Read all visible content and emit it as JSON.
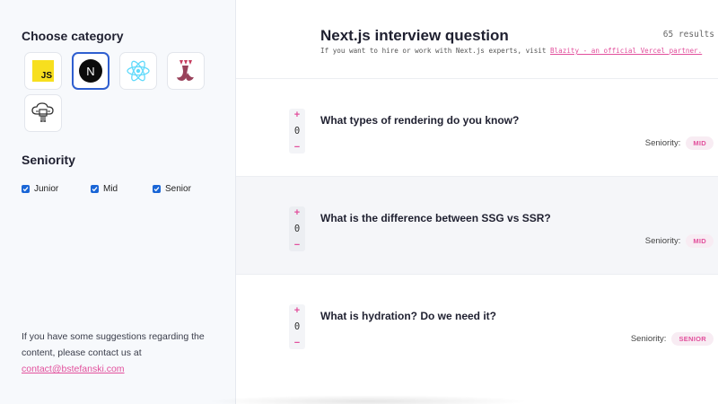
{
  "sidebar": {
    "category_title": "Choose category",
    "categories": [
      {
        "name": "javascript",
        "label": "JS",
        "selected": false
      },
      {
        "name": "nextjs",
        "label": "N",
        "selected": true
      },
      {
        "name": "react",
        "label": "",
        "selected": false
      },
      {
        "name": "jest",
        "label": "",
        "selected": false
      },
      {
        "name": "cloud-service",
        "label": "",
        "selected": false
      }
    ],
    "seniority_title": "Seniority",
    "seniority_options": [
      {
        "label": "Junior",
        "checked": true
      },
      {
        "label": "Mid",
        "checked": true
      },
      {
        "label": "Senior",
        "checked": true
      }
    ],
    "contact_text": "If you have some suggestions regarding the content, please contact us at",
    "contact_email": "contact@bstefanski.com"
  },
  "main": {
    "title": "Next.js interview question",
    "results": "65 results",
    "subtitle_prefix": "If you want to hire or work with Next.js experts, visit",
    "subtitle_link": "Blazity - an official Vercel partner.",
    "seniority_label": "Seniority:",
    "questions": [
      {
        "text": "What types of rendering do you know?",
        "votes": "0",
        "seniority": "MID"
      },
      {
        "text": "What is the difference between SSG vs SSR?",
        "votes": "0",
        "seniority": "MID"
      },
      {
        "text": "What is hydration? Do we need it?",
        "votes": "0",
        "seniority": "SENIOR"
      }
    ]
  },
  "colors": {
    "accent": "#e24f9c",
    "selected_border": "#2f5fd0",
    "checkbox": "#1a66d6",
    "js_yellow": "#f7df1e",
    "react_blue": "#61dafb",
    "jest_red": "#99425b"
  },
  "icons": {
    "js": "javascript-icon",
    "next": "nextjs-icon",
    "react": "react-icon",
    "jest": "jest-icon",
    "cloud": "cloud-chip-icon"
  }
}
